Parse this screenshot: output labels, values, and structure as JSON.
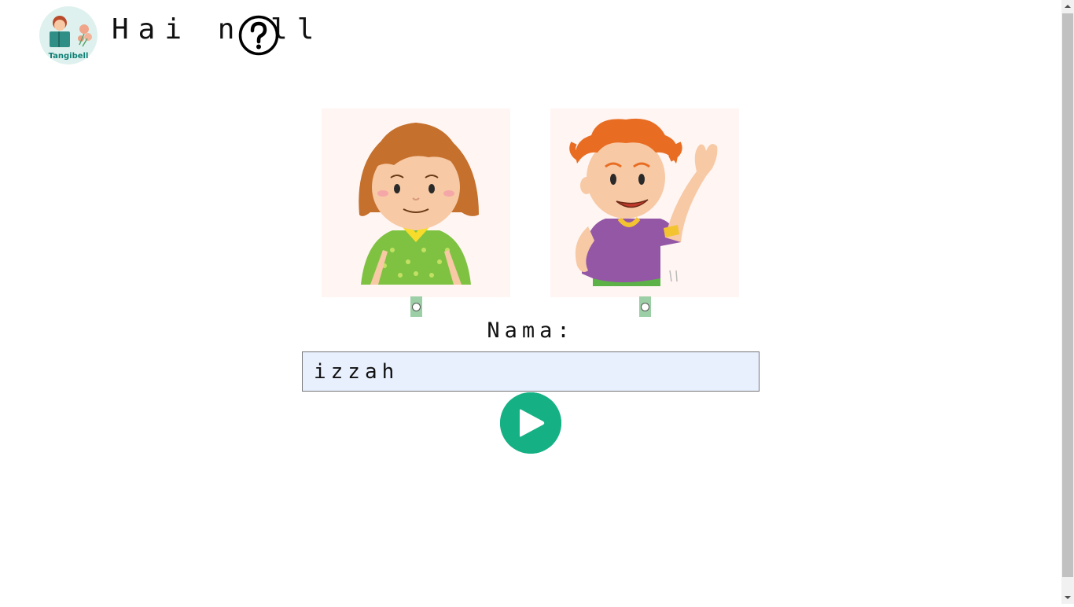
{
  "header": {
    "logo_text": "Tangibell",
    "greeting": "Hai null",
    "help_icon": "question-circle-icon"
  },
  "avatars": [
    {
      "name": "girl",
      "selected": false
    },
    {
      "name": "boy",
      "selected": false
    }
  ],
  "form": {
    "name_label": "Nama:",
    "name_value": "izzah"
  },
  "play_button": {
    "icon": "play-icon"
  },
  "colors": {
    "accent": "#15b184",
    "radio_bg": "#9ccfa5",
    "avatar_bg": "#fff5f3",
    "input_bg": "#e8f0fe"
  }
}
